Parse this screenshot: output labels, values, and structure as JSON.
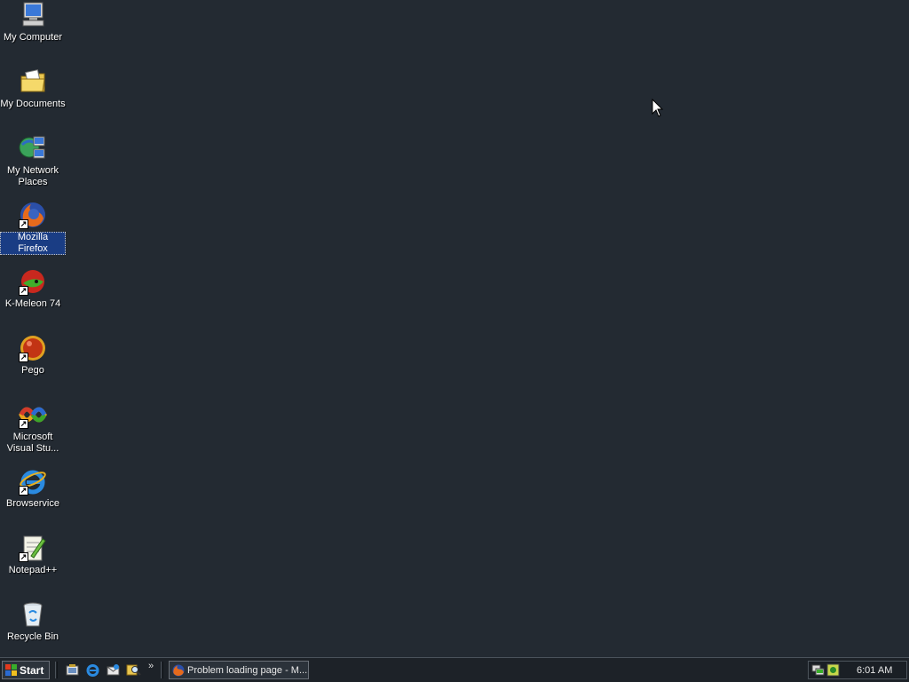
{
  "desktop": {
    "background": "#232a32",
    "icons": [
      {
        "label": "My Computer",
        "icon": "my-computer-icon",
        "shortcut": false
      },
      {
        "label": "My Documents",
        "icon": "my-documents-folder-icon",
        "shortcut": false
      },
      {
        "label": "My Network Places",
        "icon": "network-places-icon",
        "shortcut": false
      },
      {
        "label": "Mozilla Firefox",
        "icon": "firefox-icon",
        "shortcut": true,
        "selected": true
      },
      {
        "label": "K-Meleon 74",
        "icon": "k-meleon-icon",
        "shortcut": true
      },
      {
        "label": "Pego",
        "icon": "pego-icon",
        "shortcut": true
      },
      {
        "label": "Microsoft Visual Stu...",
        "icon": "visual-studio-icon",
        "shortcut": true
      },
      {
        "label": "Browservice",
        "icon": "internet-explorer-icon",
        "shortcut": true
      },
      {
        "label": "Notepad++",
        "icon": "notepad-plus-plus-icon",
        "shortcut": true
      },
      {
        "label": "Recycle Bin",
        "icon": "recycle-bin-icon",
        "shortcut": false
      }
    ]
  },
  "taskbar": {
    "start_label": "Start",
    "quick_launch": [
      "show-desktop-icon",
      "internet-explorer-icon",
      "outlook-express-icon",
      "search-icon"
    ],
    "overflow": "»",
    "tasks": [
      {
        "label": "Problem loading page - M...",
        "icon": "firefox-icon"
      }
    ],
    "tray": {
      "icons": [
        "network-tray-icon",
        "security-tray-icon"
      ],
      "clock": "6:01 AM"
    }
  }
}
